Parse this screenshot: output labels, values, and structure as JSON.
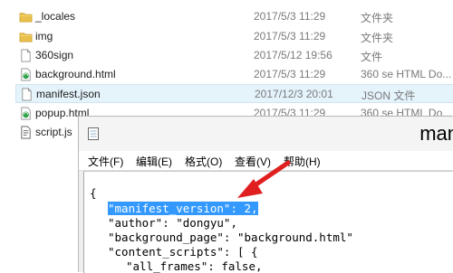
{
  "explorer": {
    "files": [
      {
        "name": "_locales",
        "date": "2017/5/3 11:29",
        "type": "文件夹",
        "icon": "folder-icon"
      },
      {
        "name": "img",
        "date": "2017/5/3 11:29",
        "type": "文件夹",
        "icon": "folder-icon"
      },
      {
        "name": "360sign",
        "date": "2017/5/12 19:56",
        "type": "文件",
        "icon": "file-icon"
      },
      {
        "name": "background.html",
        "date": "2017/5/3 11:29",
        "type": "360 se HTML Do...",
        "icon": "html-file-icon"
      },
      {
        "name": "manifest.json",
        "date": "2017/12/3 20:01",
        "type": "JSON 文件",
        "icon": "json-file-icon"
      },
      {
        "name": "popup.html",
        "date": "2017/5/3 11:29",
        "type": "360 se HTML Do...",
        "icon": "html-file-icon"
      },
      {
        "name": "script.js",
        "date": "",
        "type": "",
        "icon": "js-file-icon"
      }
    ]
  },
  "notepad": {
    "title": "man",
    "menu": [
      "文件(F)",
      "编辑(E)",
      "格式(O)",
      "查看(V)",
      "帮助(H)"
    ],
    "code": {
      "line0": "{",
      "line1_highlight": "\"manifest_version\": 2,",
      "line2": "\"author\": \"dongyu\",",
      "line3": "\"background_page\": \"background.html\"",
      "line4": "\"content_scripts\": [ {",
      "line5": "\"all_frames\": false,"
    }
  },
  "colors": {
    "highlight": "#3399ff",
    "arrow": "#e02020",
    "selected_row": "#e5f3fb",
    "folder": "#e8c04a"
  }
}
